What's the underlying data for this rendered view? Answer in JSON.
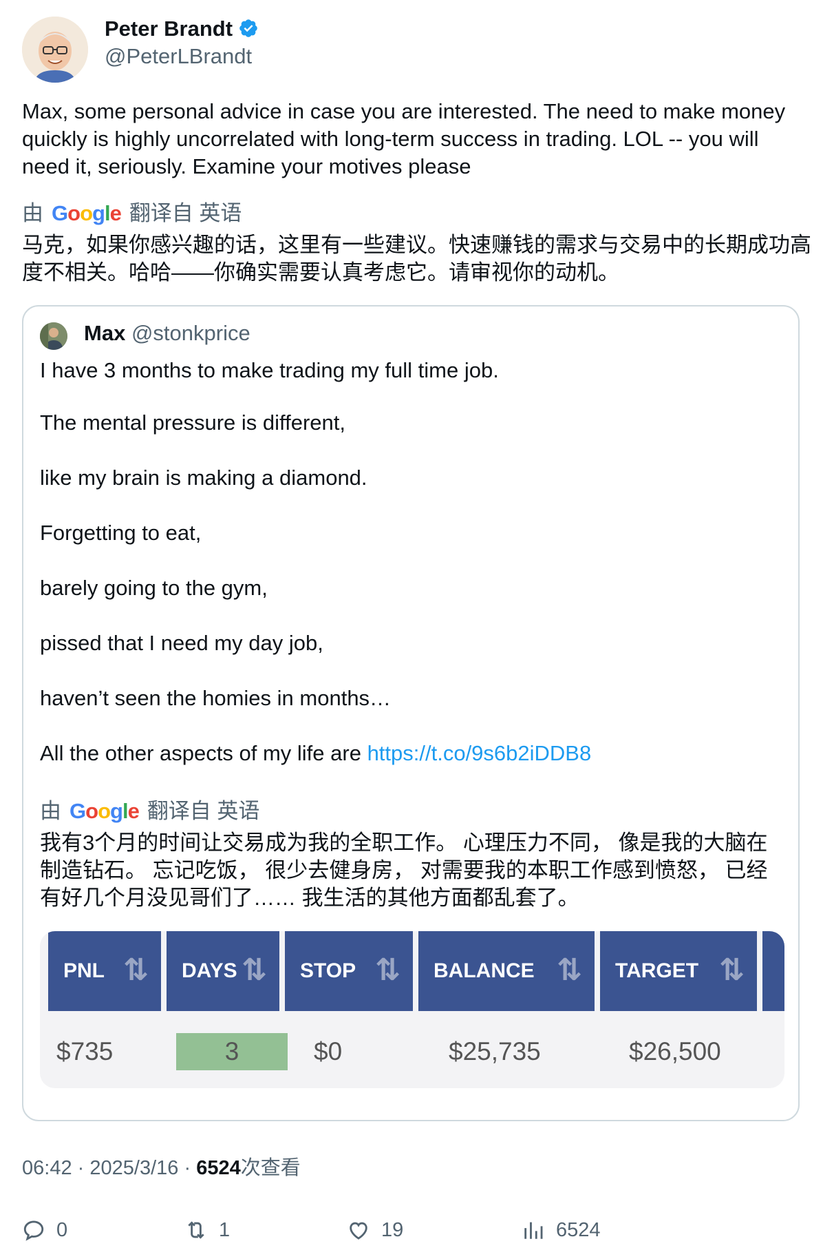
{
  "author": {
    "name": "Peter Brandt",
    "handle": "@PeterLBrandt",
    "verified": true
  },
  "tweet": {
    "text": "Max, some personal advice in case you are interested. The need to make money quickly is highly uncorrelated with long-term success in trading. LOL -- you will need it, seriously. Examine your motives please",
    "translated_prefix": "由",
    "translated_suffix": "翻译自 英语",
    "google_word": "Google",
    "translation": "马克，如果你感兴趣的话，这里有一些建议。快速赚钱的需求与交易中的长期成功高度不相关。哈哈——你确实需要认真考虑它。请审视你的动机。"
  },
  "quote": {
    "name": "Max",
    "handle": "@stonkprice",
    "lines": [
      "I have 3 months to make trading my full time job.",
      "The mental pressure is different,",
      "like my brain is making a diamond.",
      "Forgetting to eat,",
      "barely going to the gym,",
      "pissed that I need my day job,",
      "haven’t seen the homies in months…",
      "All the other aspects of my life are"
    ],
    "link": "https://t.co/9s6b2iDDB8",
    "translated_prefix": "由",
    "translated_suffix": "翻译自 英语",
    "translation": "我有3个月的时间让交易成为我的全职工作。 心理压力不同， 像是我的大脑在制造钻石。 忘记吃饭， 很少去健身房， 对需要我的本职工作感到愤怒， 已经有好几个月没见哥们了…… 我生活的其他方面都乱套了。",
    "table": {
      "headers": [
        "PNL",
        "DAYS",
        "STOP",
        "BALANCE",
        "TARGET"
      ],
      "values": [
        "$735",
        "3",
        "$0",
        "$25,735",
        "$26,500"
      ],
      "highlight_color": "#93c094",
      "header_color": "#3b5491"
    }
  },
  "meta": {
    "time": "06:42",
    "date": "2025/3/16",
    "views_count": "6524",
    "views_label": "次查看",
    "separator": "·"
  },
  "actions": {
    "replies": "0",
    "retweets": "1",
    "likes": "19",
    "views": "6524"
  },
  "colors": {
    "link": "#1d9bf0",
    "muted": "#536471",
    "verified": "#1d9bf0"
  }
}
